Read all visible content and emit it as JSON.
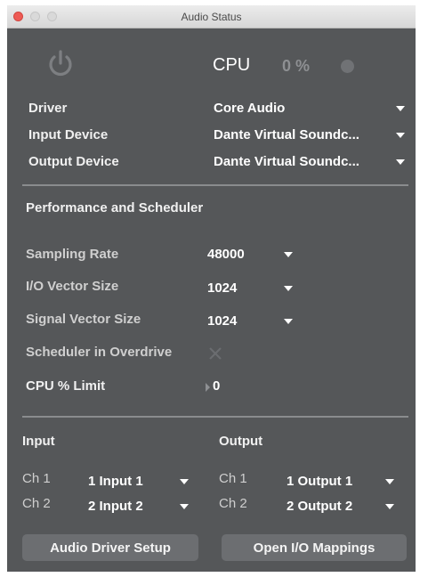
{
  "window": {
    "title": "Audio Status"
  },
  "header": {
    "cpu_label": "CPU",
    "cpu_value": "0 %"
  },
  "devices": {
    "driver_label": "Driver",
    "driver_value": "Core Audio",
    "input_label": "Input Device",
    "input_value": "Dante Virtual Soundc...",
    "output_label": "Output Device",
    "output_value": "Dante Virtual Soundc..."
  },
  "performance": {
    "heading": "Performance and Scheduler",
    "sampling_rate_label": "Sampling Rate",
    "sampling_rate_value": "48000",
    "io_vector_label": "I/O Vector Size",
    "io_vector_value": "1024",
    "signal_vector_label": "Signal Vector Size",
    "signal_vector_value": "1024",
    "overdrive_label": "Scheduler in Overdrive",
    "cpu_limit_label": "CPU % Limit",
    "cpu_limit_value": "0"
  },
  "io": {
    "input_heading": "Input",
    "output_heading": "Output",
    "inputs": [
      {
        "ch": "Ch 1",
        "value": "1 Input 1"
      },
      {
        "ch": "Ch 2",
        "value": "2 Input 2"
      }
    ],
    "outputs": [
      {
        "ch": "Ch 1",
        "value": "1 Output 1"
      },
      {
        "ch": "Ch 2",
        "value": "2 Output 2"
      }
    ]
  },
  "buttons": {
    "driver_setup": "Audio Driver Setup",
    "io_mappings": "Open I/O Mappings"
  }
}
